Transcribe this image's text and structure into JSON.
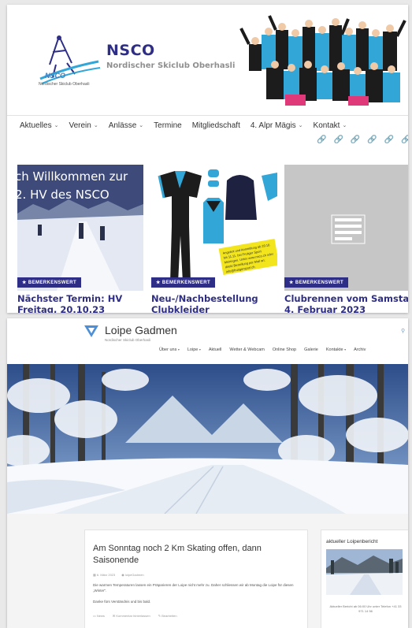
{
  "nsco": {
    "logo_text": "NSCO",
    "logo_subtitle": "Nordischer Skiclub Oberhasli",
    "title": "NSCO",
    "subtitle": "Nordischer Skiclub Oberhasli",
    "nav": [
      {
        "label": "Aktuelles",
        "dropdown": true
      },
      {
        "label": "Verein",
        "dropdown": true
      },
      {
        "label": "Anlässe",
        "dropdown": true
      },
      {
        "label": "Termine",
        "dropdown": false
      },
      {
        "label": "Mitgliedschaft",
        "dropdown": false
      },
      {
        "label": "4. Alpr Mägis",
        "dropdown": true
      },
      {
        "label": "Kontakt",
        "dropdown": true
      }
    ],
    "social_icons": [
      "link-icon",
      "link-icon",
      "link-icon",
      "link-icon",
      "link-icon",
      "link-icon"
    ],
    "cards": [
      {
        "badge": "★ BEMERKENSWERT",
        "title": "Nächster Termin: HV Freitag, 20.10.23",
        "image_text_line1": "ch Willkommen zur",
        "image_text_line2": "2. HV des NSCO"
      },
      {
        "badge": "★ BEMERKENSWERT",
        "title": "Neu-/Nachbestellung Clubkleider",
        "note": "Angebot und Anmeldung ab 20.10. bis 11.11. bei Frutiger Sport Meiringen. Unter www.nsco.ch oder direkt Bestellung per Mail an: info@frutigersport.ch"
      },
      {
        "badge": "★ BEMERKENSWERT",
        "title": "Clubrennen vom Samstag, 4. Februar 2023"
      }
    ],
    "colors": {
      "brand": "#2f2e86",
      "accent": "#33a6d8"
    }
  },
  "loipe": {
    "title": "Loipe Gadmen",
    "subtitle": "Nordischer Skiclub Oberhasli",
    "nav": [
      {
        "label": "Über uns",
        "dropdown": true
      },
      {
        "label": "Loipe",
        "dropdown": true
      },
      {
        "label": "Aktuell",
        "dropdown": false
      },
      {
        "label": "Wetter & Webcam",
        "dropdown": false
      },
      {
        "label": "Online Shop",
        "dropdown": false
      },
      {
        "label": "Galerie",
        "dropdown": false
      },
      {
        "label": "Kontakte",
        "dropdown": true
      },
      {
        "label": "Archiv",
        "dropdown": false
      }
    ],
    "post": {
      "title": "Am Sonntag noch 2 Km Skating offen, dann Saisonende",
      "date": "6. März 2023",
      "author": "loipeGadmen",
      "body": "Die warmen Temperaturen lassen ein Präparieren der Loipe nicht mehr zu. Daher schliessen wir ab Montag die Loipe für diesen „Winter\".",
      "body2": "Danke fürs Verständnis und bis bald.",
      "category": "News",
      "comments": "Kommentar hinterlassen",
      "edit": "Bearbeiten"
    },
    "widget": {
      "title": "aktueller Loipenbericht",
      "text": "Aktueller Bericht ab 06:00 Uhr unter Telefon +41 33 971 14 56"
    }
  }
}
